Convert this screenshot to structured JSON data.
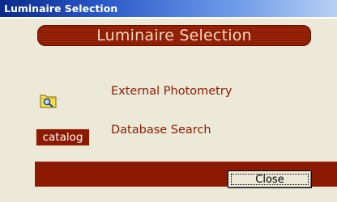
{
  "window": {
    "title": "Luminaire Selection"
  },
  "banner": {
    "title": "Luminaire Selection"
  },
  "options": [
    {
      "icon": "folder-search-icon",
      "label": "External Photometry"
    },
    {
      "button_label": "catalog",
      "label": "Database Search"
    }
  ],
  "footer": {
    "close_label": "Close"
  },
  "colors": {
    "accent": "#8b1a00",
    "banner_text": "#f2d6c4",
    "background": "#ece9d8",
    "title_bar": "#0a2a8a"
  }
}
